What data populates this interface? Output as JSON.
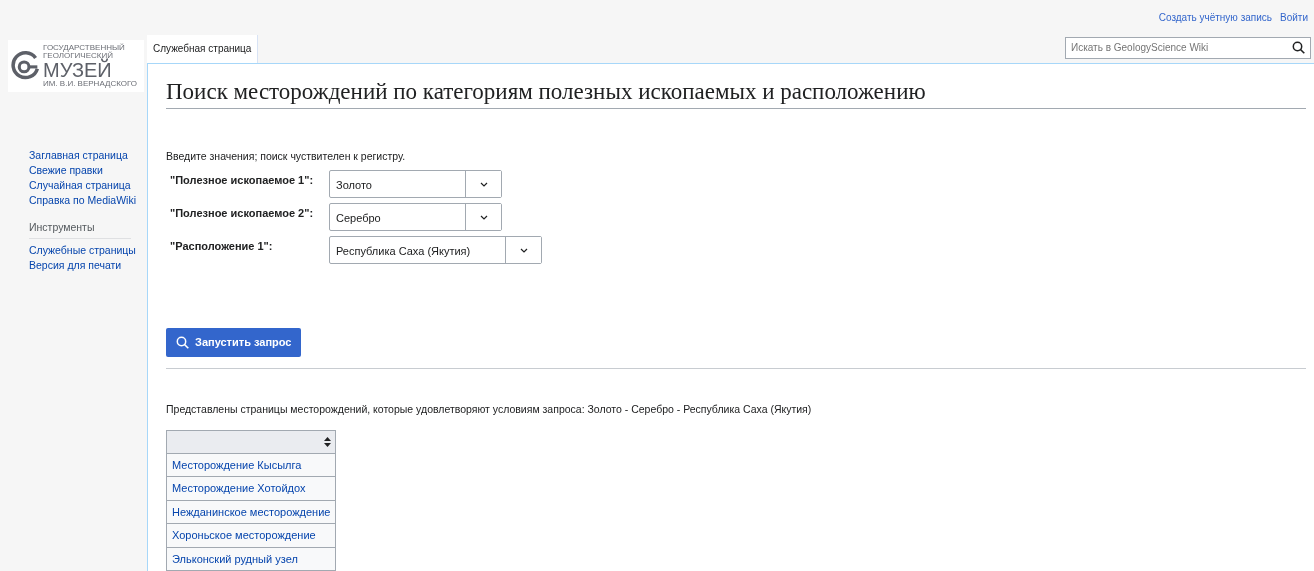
{
  "personal_links": [
    "Создать учётную запись",
    "Войти"
  ],
  "logo": {
    "top_line": "ГОСУДАРСТВЕННЫЙ",
    "second_line": "ГЕОЛОГИЧЕСКИЙ",
    "main": "МУЗЕЙ",
    "bottom_line": "ИМ. В.И. ВЕРНАДСКОГО"
  },
  "tabs": [
    {
      "label": "Служебная страница",
      "selected": true
    }
  ],
  "search": {
    "placeholder": "Искать в GeologyScience Wiki"
  },
  "sidebar": {
    "navigation": [
      "Заглавная страница",
      "Свежие правки",
      "Случайная страница",
      "Справка по MediaWiki"
    ],
    "tools_heading": "Инструменты",
    "tools": [
      "Служебные страницы",
      "Версия для печати"
    ]
  },
  "title": "Поиск месторождений по категориям полезных ископаемых и расположению",
  "intro": "Введите значения; поиск чуствителен к регистру.",
  "fields": [
    {
      "label": "\"Полезное ископаемое 1\":",
      "value": "Золото"
    },
    {
      "label": "\"Полезное ископаемое 2\":",
      "value": "Серебро"
    },
    {
      "label": "\"Расположение 1\":",
      "value": "Республика Саха (Якутия)"
    }
  ],
  "run_button": "Запустить запрос",
  "results_text": "Представлены страницы месторождений, которые удовлетворяют условиям запроса: Золото - Серебро - Республика Саха (Якутия)",
  "results": [
    "Месторождение Кысылга",
    "Месторождение Хотойдох",
    "Нежданинское месторождение",
    "Хороньское месторождение",
    "Эльконский рудный узел"
  ]
}
